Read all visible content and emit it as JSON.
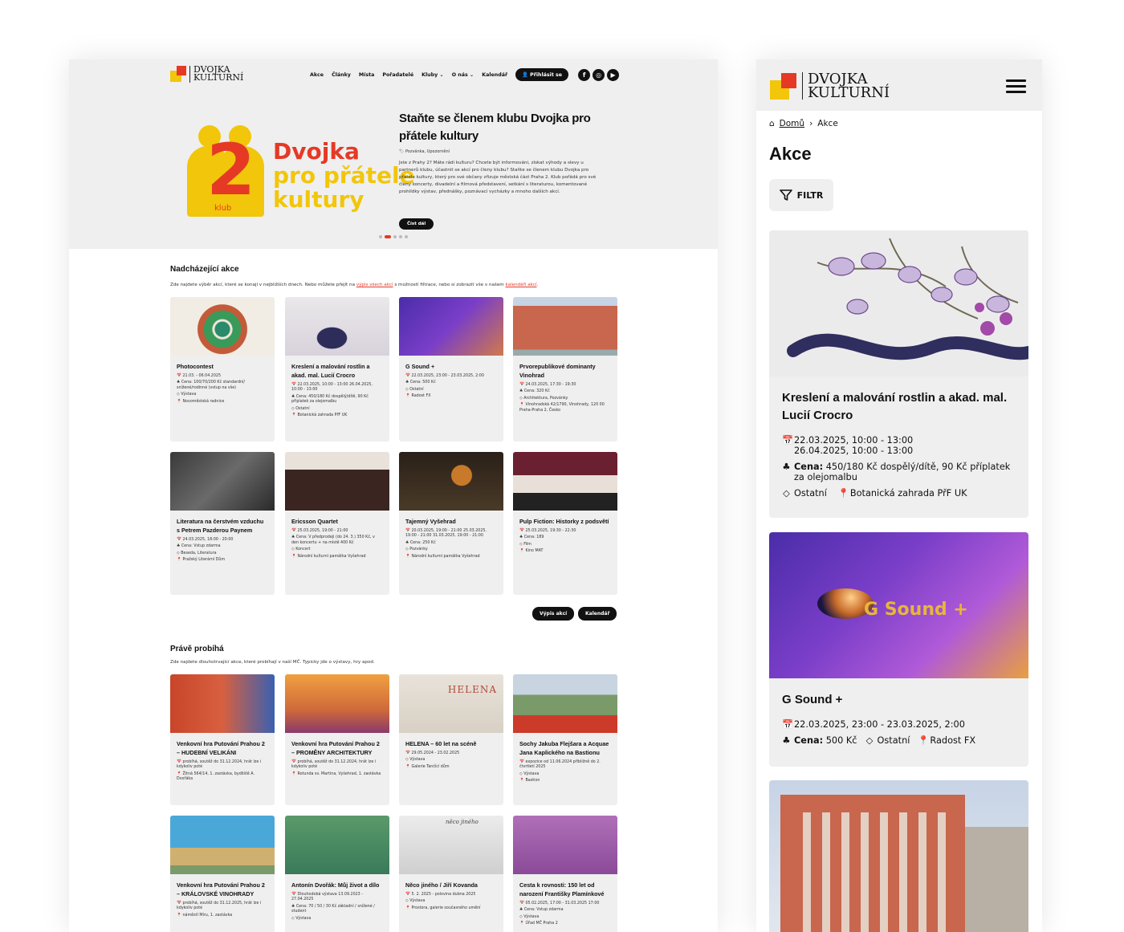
{
  "desktop": {
    "logo": {
      "line1": "DVOJKA",
      "line2": "KULTURNÍ"
    },
    "nav": {
      "items": [
        "Akce",
        "Články",
        "Místa",
        "Pořadatelé",
        "Kluby ⌄",
        "O nás ⌄",
        "Kalendář"
      ],
      "login": "Přihlásit se"
    },
    "social_icons": [
      "facebook-icon",
      "instagram-icon",
      "youtube-icon"
    ],
    "hero": {
      "image_text": {
        "line1": "Dvojka",
        "line2": "pro přátele",
        "line3": "kultury",
        "two": "2",
        "klub": "klub"
      },
      "title": "Staňte se členem klubu Dvojka pro přátele kultury",
      "meta": "Pozvánka, Upozornění",
      "text": "Jste z Prahy 2? Máte rádi kulturu? Chcete být informováni, získat výhody a slevy u partnerů klubu, účastnit se akcí pro členy klubu? Staňte se členem klubu Dvojka pro přátele kultury, který pro své občany zřizuje městská část Praha 2. Klub pořádá pro své členy koncerty, divadelní a filmová představení, setkání s literaturou, komentované prohlídky výstav, přednášky, poznávací vycházky a mnoho dalších akcí.",
      "button": "Číst dál"
    },
    "upcoming": {
      "title": "Nadcházející akce",
      "desc_pre": "Zde najdete výběr akcí, které se konají v nejbližších dnech. Nebo můžete přejít na ",
      "desc_link1": "výpis všech akcí",
      "desc_mid": " s možností filtrace, nebo si zobrazit vše v našem ",
      "desc_link2": "kalendáři akcí",
      "desc_post": ".",
      "cards": [
        {
          "title": "Photocontest",
          "date": "21.03. - 06.04.2025",
          "price": "Cena: 100/70/200 Kč standardní/ snížené/rodinné (vstup na vše)",
          "tags": "Výstava",
          "place": "Novoměstská radnice"
        },
        {
          "title": "Kreslení a malování rostlin a akad. mal. Lucií Crocro",
          "date": "22.03.2025, 10:00 - 13:00 26.04.2025, 10:00 - 13:00",
          "price": "Cena: 450/180 Kč dospělý/dítě, 90 Kč příplatek za olejomalbu",
          "tags": "Ostatní",
          "place": "Botanická zahrada PřF UK"
        },
        {
          "title": "G Sound +",
          "date": "22.03.2025, 23:00 - 23.03.2025, 2:00",
          "price": "Cena: 500 Kč",
          "tags": "Ostatní",
          "place": "Radost FX"
        },
        {
          "title": "Prvorepublikové dominanty Vinohrad",
          "date": "24.03.2025, 17:30 - 19:30",
          "price": "Cena: 320 Kč",
          "tags": "Architektura, Pozvánky",
          "place": "Vinohradská 42/1790, Vinohrady, 120 00 Praha-Praha 2, Česko"
        },
        {
          "title": "Literatura na čerstvém vzduchu s Petrem Pazderou Paynem",
          "date": "24.03.2025, 18:00 - 20:00",
          "price": "Cena: Vstup zdarma",
          "tags": "Beseda, Literatura",
          "place": "Pražský Literární Dům"
        },
        {
          "title": "Ericsson Quartet",
          "date": "25.03.2025, 19:00 - 21:00",
          "price": "Cena: V předprodeji (do 24. 3.) 350 Kč, v den koncertu + na místě 400 Kč",
          "tags": "Koncert",
          "place": "Národní kulturní památka Vyšehrad"
        },
        {
          "title": "Tajemný Vyšehrad",
          "date": "20.03.2025, 19:00 - 21:00 25.03.2025, 19:00 - 21:00 31.03.2025, 19:00 - 21:00",
          "price": "Cena: 250 Kč",
          "tags": "Pozvánky",
          "place": "Národní kulturní památka Vyšehrad"
        },
        {
          "title": "Pulp Fiction: Historky z podsvětí",
          "date": "25.03.2025, 19:30 - 22:30",
          "price": "Cena: 189",
          "tags": "Film",
          "place": "Kino MAT"
        }
      ],
      "btn_list": "Výpis akcí",
      "btn_cal": "Kalendář"
    },
    "ongoing": {
      "title": "Právě probíhá",
      "desc": "Zde najdete dlouhotrvající akce, které probíhají v naší MČ. Typicky jde o výstavy, hry apod.",
      "cards": [
        {
          "title": "Venkovní hra Putování Prahou 2 – HUDEBNÍ VELIKÁNI",
          "date": "probíhá, soutěž do 31.12.2024, hrát lze i kdykoliv poté",
          "place": "Žitná 564/14, 1. zastávka, bydliště A. Dvořáka"
        },
        {
          "title": "Venkovní hra Putování Prahou 2 – PROMĚNY ARCHITEKTURY",
          "date": "probíhá, soutěž do 31.12.2024, hrát lze i kdykoliv poté",
          "place": "Rotunda sv. Martina, Vyšehrad, 1. zastávka"
        },
        {
          "title": "HELENA – 60 let na scéně",
          "date": "29.05.2024 - 23.02.2025",
          "tags": "Výstava",
          "place": "Galerie Tančící dům"
        },
        {
          "title": "Sochy Jakuba Flejšara a Acquae Jana Kaplického na Bastionu",
          "date": "expozice od 11.06.2024 přibližně do 2. čtvrtletí 2025",
          "tags": "Výstava",
          "place": "Bastion"
        },
        {
          "title": "Venkovní hra Putování Prahou 2 – KRÁLOVSKÉ VINOHRADY",
          "date": "probíhá, soutěž do 31.12.2025, hrát lze i kdykoliv poté",
          "place": "náměstí Míru, 1. zastávka"
        },
        {
          "title": "Antonín Dvořák: Můj život a dílo",
          "date": "Dlouhodobá výstava 13.09.2023 - 27.04.2025",
          "price": "Cena: 70 / 50 / 30 Kč základní / snížené / student",
          "tags": "Výstava"
        },
        {
          "title": "Něco jiného / Jiří Kovanda",
          "date": "5. 2. 2025 - polovina dubna 2025",
          "tags": "Výstava",
          "place": "Prostora, galerie současného umění"
        },
        {
          "title": "Cesta k rovnosti: 150 let od narození Františky Plamínkové",
          "date": "05.02.2025, 17:00 - 31.03.2025 17:00",
          "price": "Cena: Vstup zdarma",
          "tags": "Výstava",
          "place": "Úřad MČ Praha 2"
        }
      ],
      "image_labels": {
        "helena": "HELENA",
        "neco": "něco jiného"
      }
    }
  },
  "mobile": {
    "logo": {
      "line1": "DVOJKA",
      "line2": "KULTURNÍ"
    },
    "breadcrumb": {
      "home": "Domů",
      "sep": "›",
      "current": "Akce"
    },
    "page_title": "Akce",
    "filter": "FILTR",
    "cards": [
      {
        "title": "Kreslení a malování rostlin a akad. mal. Lucií Crocro",
        "date1": "22.03.2025, 10:00 - 13:00",
        "date2": "26.04.2025, 10:00 - 13:00",
        "price_label": "Cena:",
        "price": " 450/180 Kč dospělý/dítě, 90 Kč příplatek za olejomalbu",
        "tags": "Ostatní",
        "place": "Botanická zahrada PřF UK"
      },
      {
        "title": "G Sound +",
        "date1": "22.03.2025, 23:00 - 23.03.2025, 2:00",
        "price_label": "Cena:",
        "price": " 500 Kč",
        "tags": "Ostatní",
        "place": "Radost FX",
        "image_text": "G Sound +"
      }
    ]
  },
  "colors": {
    "accent_red": "#e53926",
    "accent_yellow": "#f2c60a",
    "panel_grey": "#efefef",
    "dark": "#111111"
  }
}
